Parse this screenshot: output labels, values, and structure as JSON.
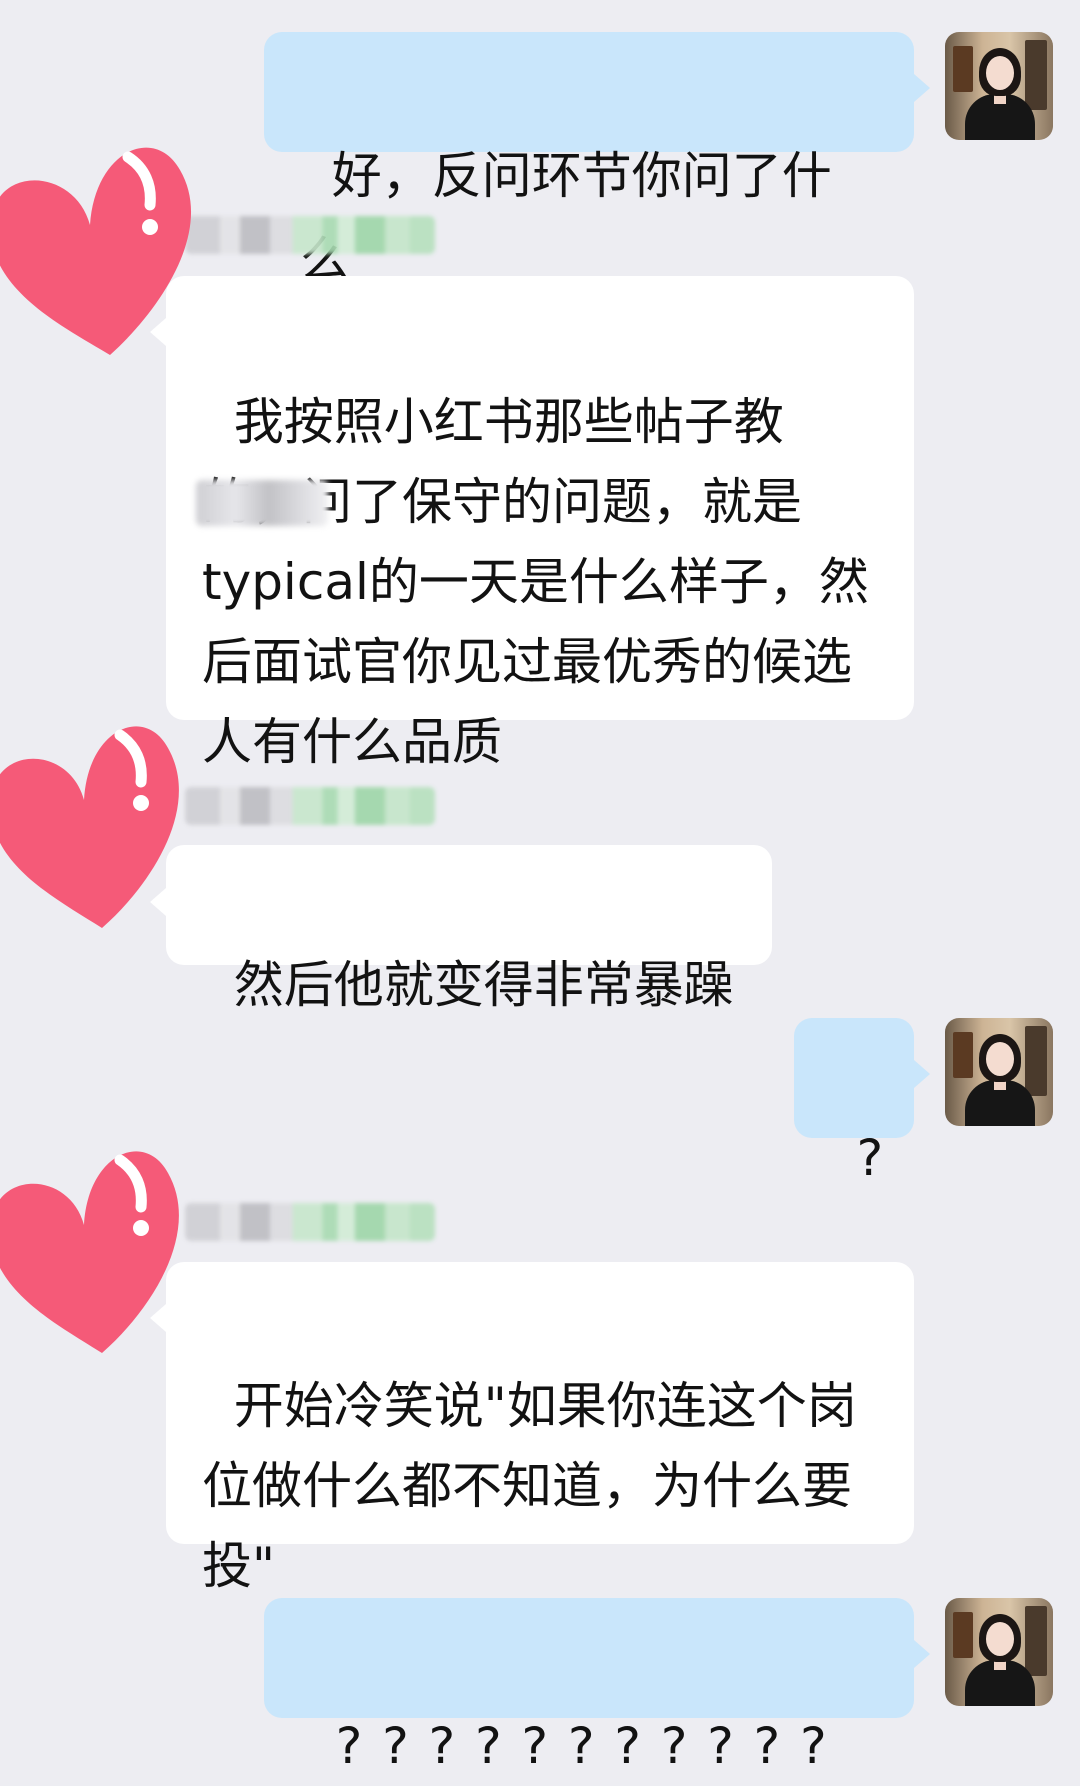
{
  "messages": [
    {
      "sender": "me",
      "text": "好，反问环节你问了什么"
    },
    {
      "sender": "other",
      "text": "我按照小红书那些帖子教的，问了保守的问题，就是        typical的一天是什么样子，然后面试官你见过最优秀的候选人有什么品质"
    },
    {
      "sender": "other",
      "text": "然后他就变得非常暴躁"
    },
    {
      "sender": "me",
      "text": "?"
    },
    {
      "sender": "other",
      "text": "开始冷笑说\"如果你连这个岗位做什么都不知道，为什么要投\""
    },
    {
      "sender": "me",
      "text": "? ? ? ? ? ? ? ? ? ? ?"
    }
  ],
  "colors": {
    "background": "#ededf2",
    "me_bubble": "#c9e6fb",
    "other_bubble": "#ffffff",
    "heart": "#f55a78",
    "heart_highlight": "#ffffff"
  },
  "icons": {
    "sticker": "heart-sticker",
    "avatar": "user-avatar"
  }
}
